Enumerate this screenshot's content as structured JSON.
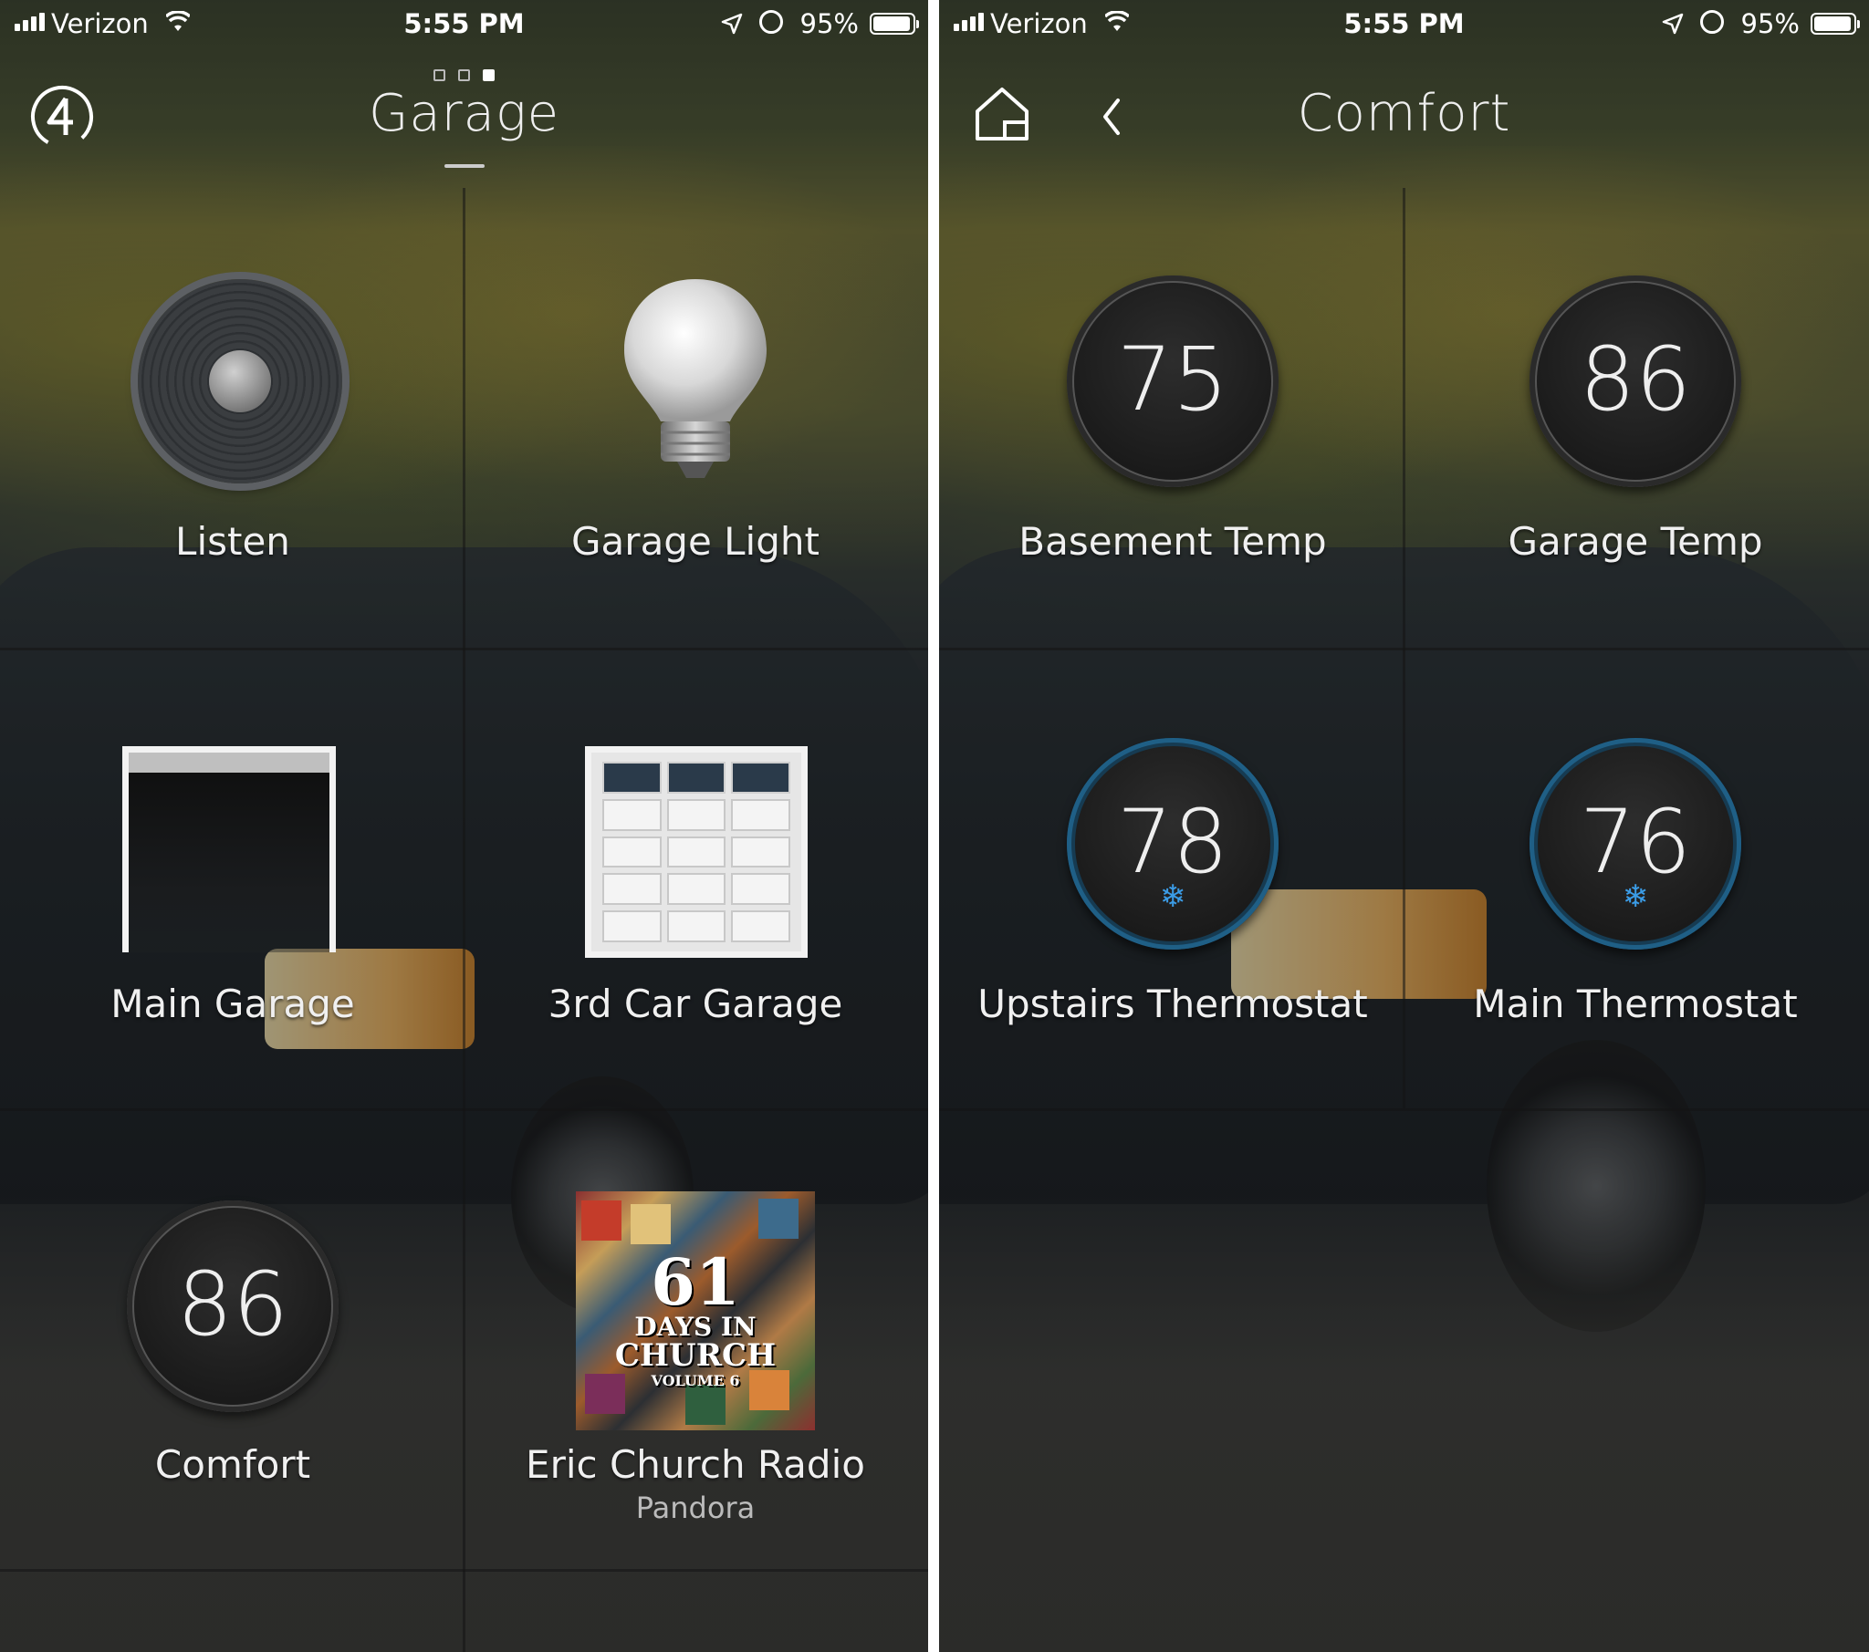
{
  "status_bar": {
    "carrier": "Verizon",
    "time": "5:55 PM",
    "battery": "95%"
  },
  "left_screen": {
    "title": "Garage",
    "page_count": 3,
    "active_page": 3,
    "tiles": [
      {
        "label": "Listen",
        "icon": "speaker-icon"
      },
      {
        "label": "Garage Light",
        "icon": "lightbulb-icon"
      },
      {
        "label": "Main Garage",
        "icon": "garage-door-open-icon"
      },
      {
        "label": "3rd Car Garage",
        "icon": "garage-door-closed-icon"
      },
      {
        "label": "Comfort",
        "value": "86"
      },
      {
        "label": "Eric Church Radio",
        "sublabel": "Pandora",
        "album_text_1": "61",
        "album_text_2": "DAYS IN",
        "album_text_3": "CHURCH",
        "album_text_4": "VOLUME 6"
      }
    ]
  },
  "right_screen": {
    "title": "Comfort",
    "tiles": [
      {
        "label": "Basement Temp",
        "value": "75",
        "mode": "none"
      },
      {
        "label": "Garage Temp",
        "value": "86",
        "mode": "none"
      },
      {
        "label": "Upstairs Thermostat",
        "value": "78",
        "mode": "cool"
      },
      {
        "label": "Main Thermostat",
        "value": "76",
        "mode": "cool"
      }
    ]
  },
  "colors": {
    "cool_ring": "#1f5f86",
    "snowflake": "#3b9ce6",
    "text": "#f0f0f0"
  }
}
